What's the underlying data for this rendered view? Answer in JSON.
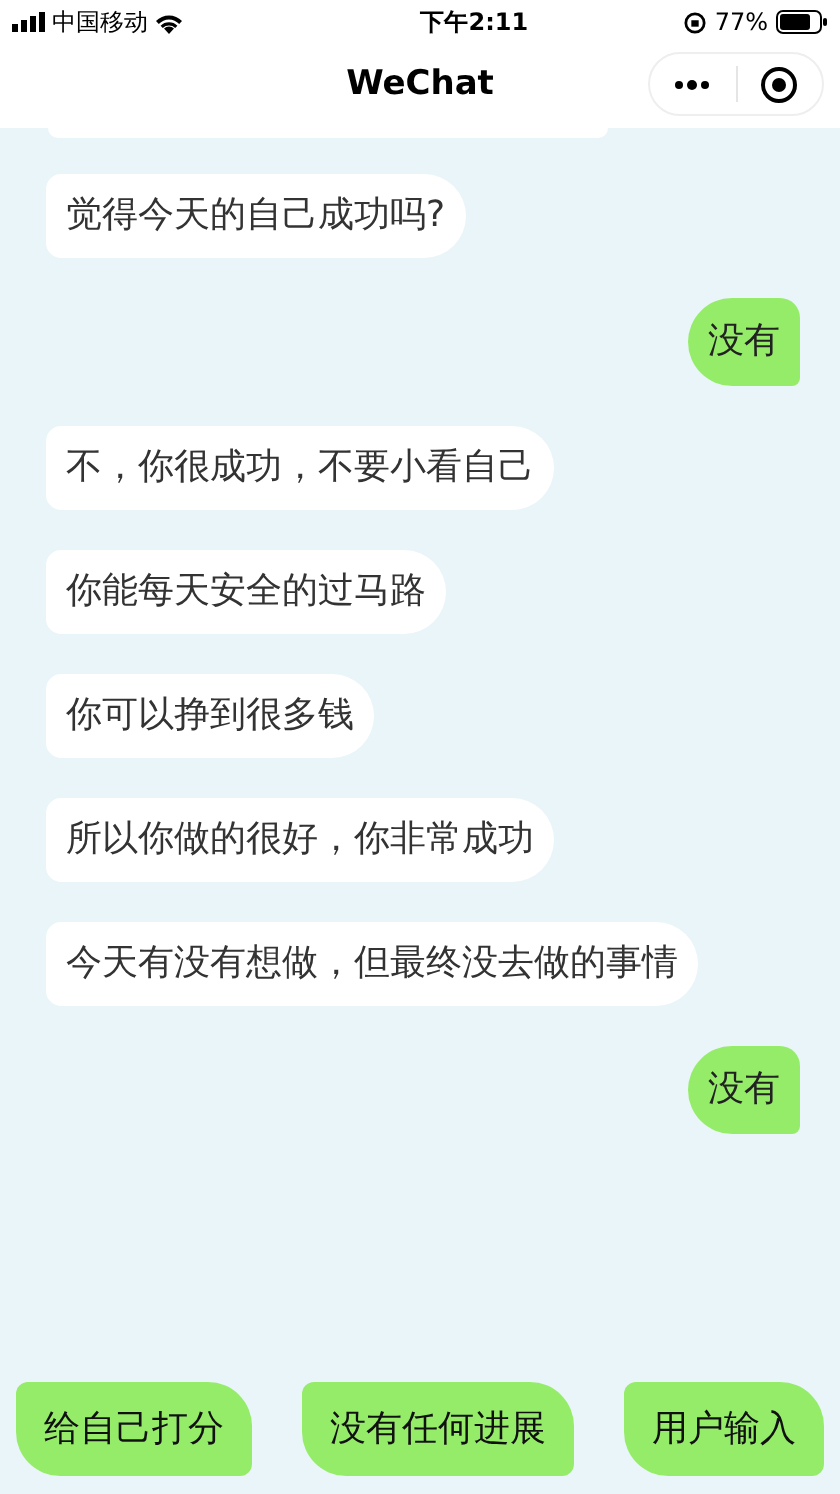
{
  "status_bar": {
    "carrier": "中国移动",
    "time": "下午2:11",
    "battery": "77%"
  },
  "nav_bar": {
    "title": "WeChat"
  },
  "messages": [
    {
      "kind": "received",
      "text": "觉得今天的自己成功吗?"
    },
    {
      "kind": "sent",
      "text": "没有"
    },
    {
      "kind": "received",
      "text": "不，你很成功，不要小看自己"
    },
    {
      "kind": "received",
      "text": "你能每天安全的过马路"
    },
    {
      "kind": "received",
      "text": "你可以挣到很多钱"
    },
    {
      "kind": "received",
      "text": "所以你做的很好，你非常成功"
    },
    {
      "kind": "received",
      "text": "今天有没有想做，但最终没去做的事情"
    },
    {
      "kind": "sent",
      "text": "没有"
    }
  ],
  "quick_replies": [
    "给自己打分",
    "没有任何进展",
    "用户输入"
  ]
}
